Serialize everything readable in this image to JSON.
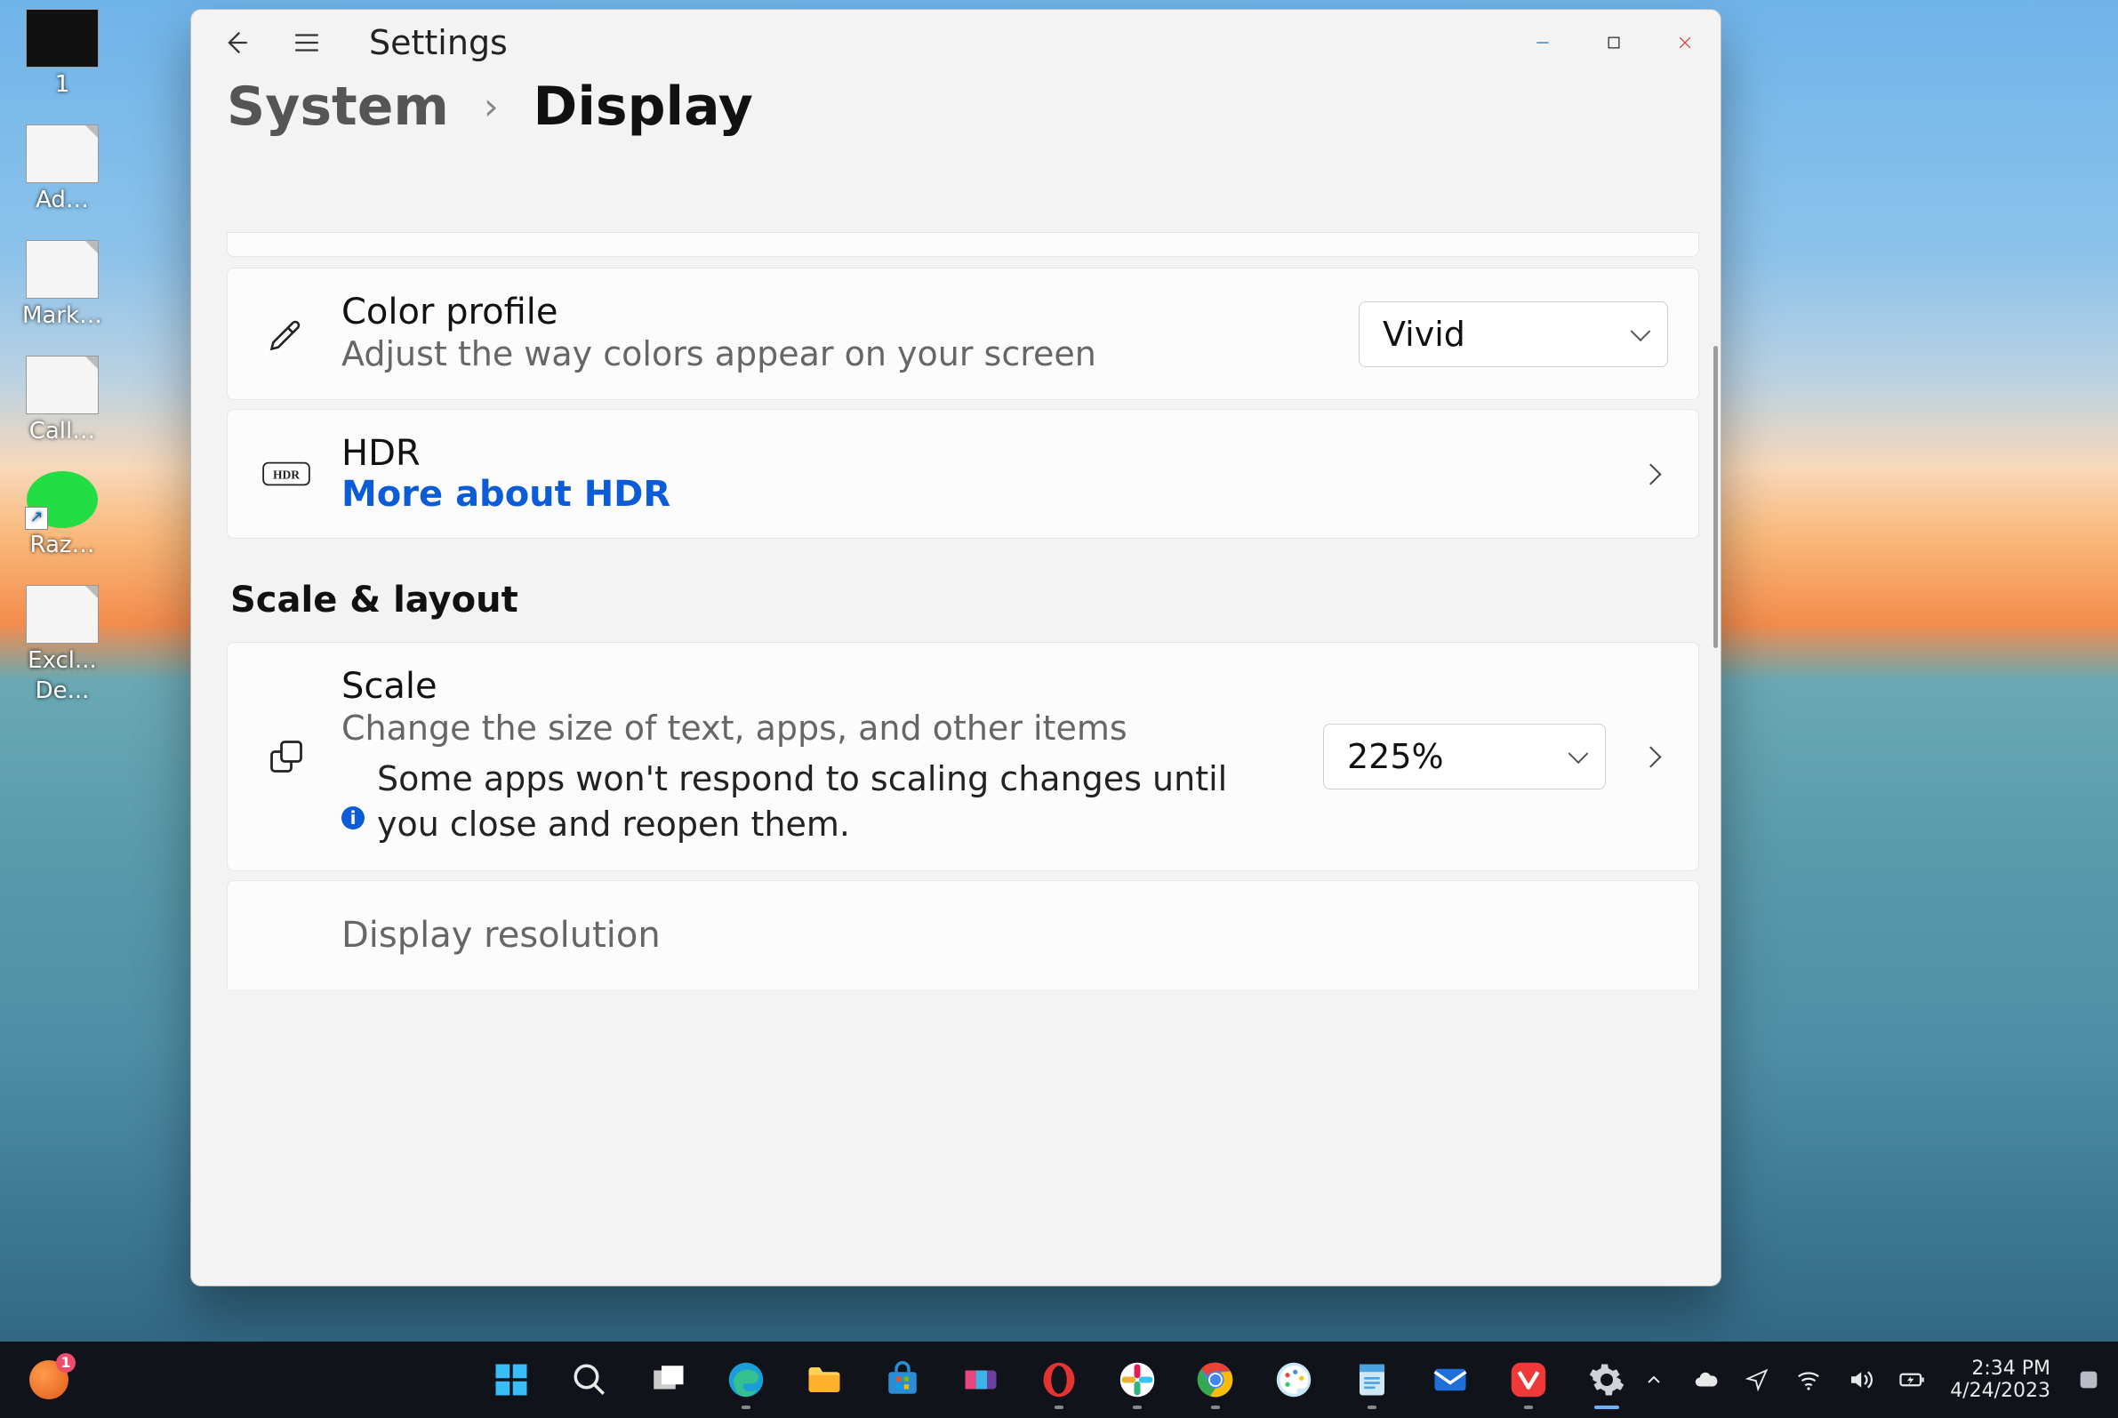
{
  "desktopIcons": {
    "i0": "1",
    "i1": "Ad…",
    "i2": "Mark…",
    "i3": "Call…",
    "i4": "Raz…",
    "i5": "Excl...",
    "i6": "De..."
  },
  "settings": {
    "appTitle": "Settings",
    "crumbRoot": "System",
    "crumbSep": "›",
    "crumbLeaf": "Display",
    "colorProfile": {
      "title": "Color profile",
      "sub": "Adjust the way colors appear on your screen",
      "value": "Vivid"
    },
    "hdr": {
      "title": "HDR",
      "link": "More about HDR"
    },
    "sectionScaleLayout": "Scale & layout",
    "scale": {
      "title": "Scale",
      "sub": "Change the size of text, apps, and other items",
      "note": "Some apps won't respond to scaling changes until you close and reopen them.",
      "value": "225%"
    },
    "resolution": {
      "title": "Display resolution"
    }
  },
  "taskbar": {
    "time": "2:34 PM",
    "date": "4/24/2023"
  }
}
